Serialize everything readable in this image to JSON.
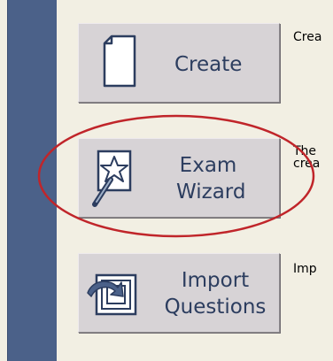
{
  "buttons": {
    "create": {
      "label": "Create",
      "icon": "blank-page-icon"
    },
    "exam_wizard": {
      "label_line1": "Exam",
      "label_line2": "Wizard",
      "icon": "magic-wand-icon"
    },
    "import_questions": {
      "label_line1": "Import",
      "label_line2": "Questions",
      "icon": "import-arrow-icon"
    }
  },
  "descriptions": {
    "create": "Crea",
    "exam_wizard_line1": "The",
    "exam_wizard_line2": "crea",
    "import_questions": "Imp"
  },
  "colors": {
    "sidebar": "#4b6189",
    "background": "#f2efe3",
    "button_face": "#d7d3d6",
    "label_text": "#2c3d5f",
    "highlight_ellipse": "#c0252a"
  }
}
